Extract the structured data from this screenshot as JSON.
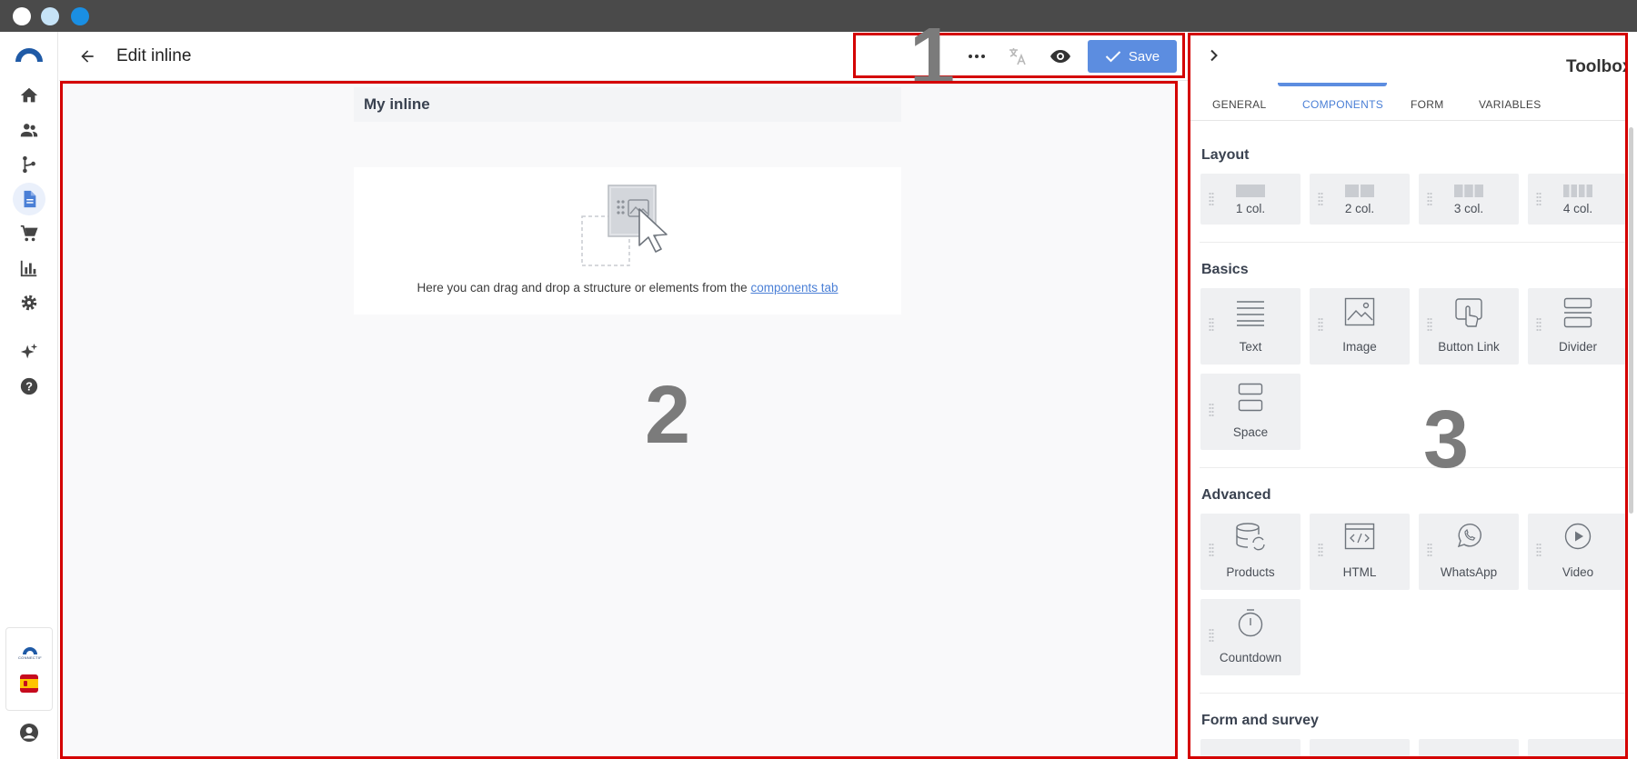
{
  "header": {
    "title": "Edit inline",
    "save_label": "Save",
    "annotation_1": "1"
  },
  "canvas": {
    "inline_name": "My inline",
    "drop_text": "Here you can drag and drop a structure or elements from the",
    "drop_link": "components tab",
    "annotation_2": "2"
  },
  "toolbox": {
    "title": "Toolbox",
    "annotation_3": "3",
    "tabs": [
      {
        "label": "GENERAL"
      },
      {
        "label": "COMPONENTS"
      },
      {
        "label": "FORM"
      },
      {
        "label": "VARIABLES"
      }
    ],
    "active_tab": "COMPONENTS",
    "sections": {
      "layout": {
        "title": "Layout",
        "items": [
          "1 col.",
          "2 col.",
          "3 col.",
          "4 col."
        ]
      },
      "basics": {
        "title": "Basics",
        "items": [
          "Text",
          "Image",
          "Button Link",
          "Divider",
          "Space"
        ]
      },
      "advanced": {
        "title": "Advanced",
        "items": [
          "Products",
          "HTML",
          "WhatsApp",
          "Video",
          "Countdown"
        ]
      },
      "form": {
        "title": "Form and survey"
      }
    }
  },
  "rail": {
    "brand_mini": "CONNECTIF",
    "items": [
      "home-icon",
      "users-icon",
      "workflow-icon",
      "document-icon",
      "cart-icon",
      "chart-icon",
      "gear-icon",
      "sparkle-icon",
      "help-icon"
    ]
  },
  "colors": {
    "accent": "#5c8de0",
    "annotation": "#d40000"
  }
}
